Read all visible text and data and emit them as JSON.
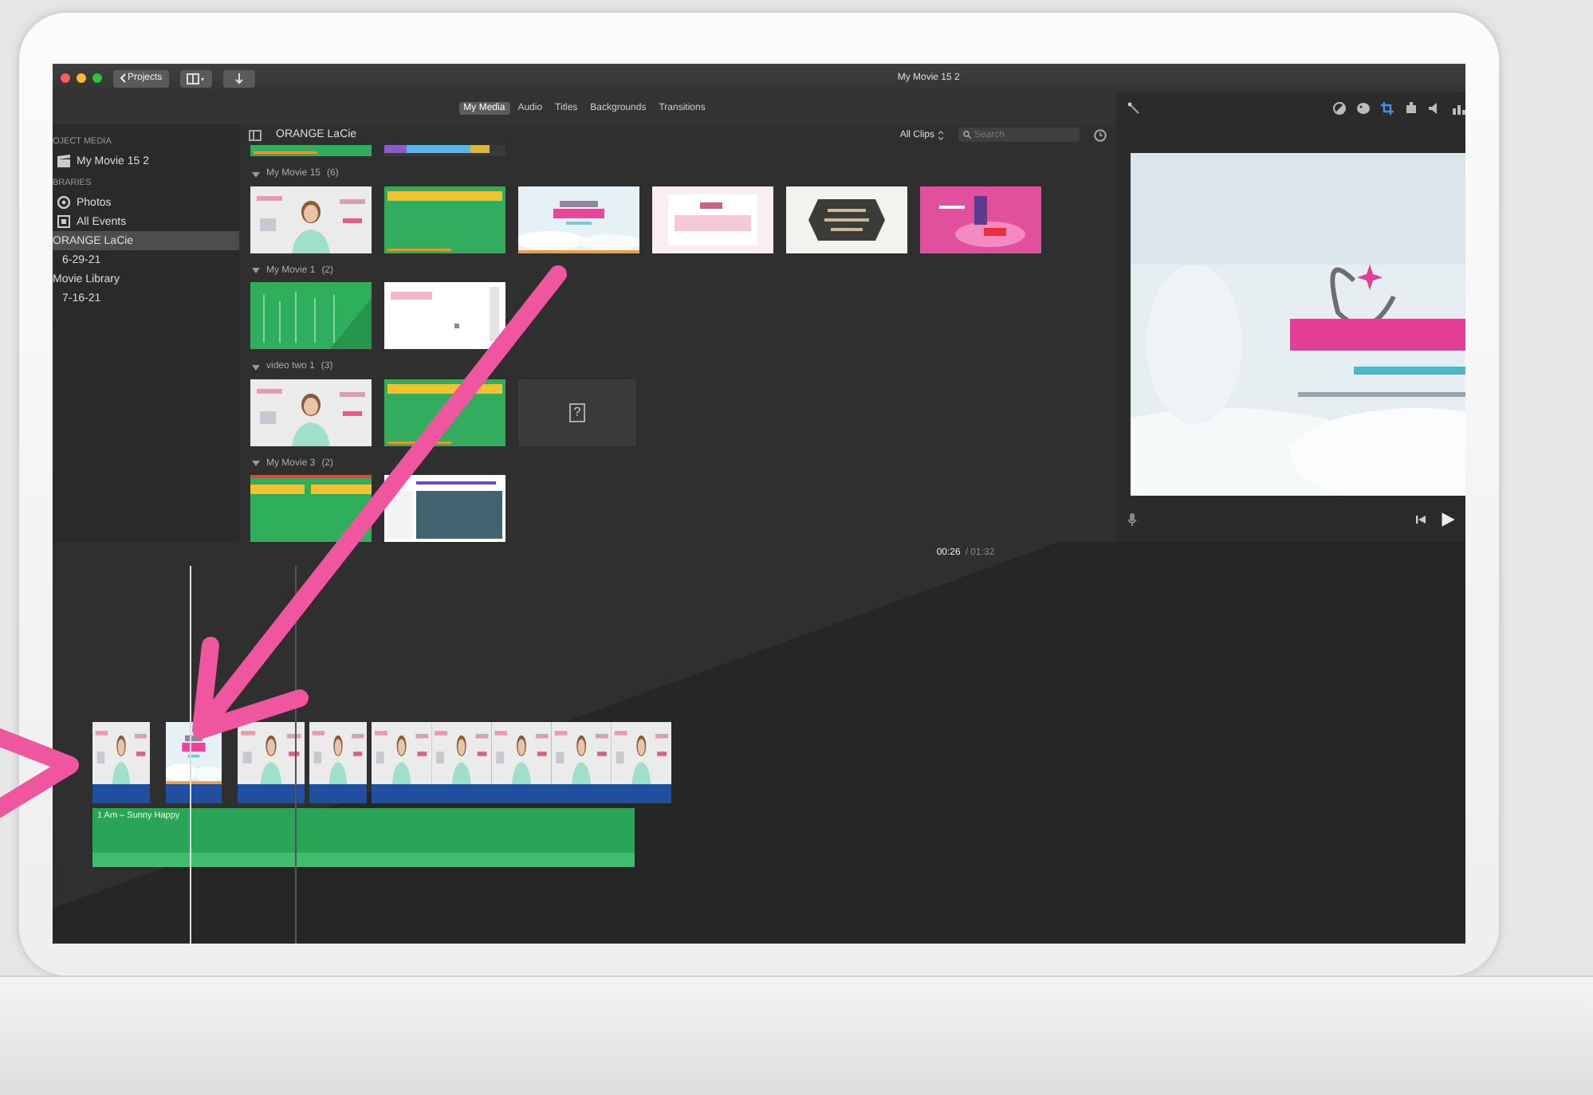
{
  "window": {
    "title": "My Movie 15 2",
    "controls": [
      {
        "kind": "close"
      },
      {
        "kind": "minimize"
      },
      {
        "kind": "zoom"
      }
    ],
    "toolbar": [
      {
        "kind": "projects",
        "label": "Projects"
      },
      {
        "kind": "clips"
      },
      {
        "kind": "import"
      }
    ]
  },
  "tabs": [
    {
      "label": "My Media",
      "selected": true
    },
    {
      "label": "Audio",
      "selected": false
    },
    {
      "label": "Titles",
      "selected": false
    },
    {
      "label": "Backgrounds",
      "selected": false
    },
    {
      "label": "Transitions",
      "selected": false
    }
  ],
  "sidebar": {
    "sections": [
      {
        "title": "OJECT MEDIA",
        "items": [
          {
            "label": "My Movie 15 2",
            "kind": "project",
            "selected": false
          }
        ]
      },
      {
        "title": "BRARIES",
        "items": [
          {
            "label": "Photos",
            "kind": "photos",
            "selected": false
          },
          {
            "label": "All Events",
            "kind": "events",
            "selected": false
          },
          {
            "label": "ORANGE LaCie",
            "kind": "library",
            "selected": true,
            "children": [
              {
                "label": "6-29-21",
                "selected": false
              }
            ]
          },
          {
            "label": "Movie Library",
            "kind": "library",
            "selected": false,
            "children": [
              {
                "label": "7-16-21",
                "selected": false
              }
            ]
          }
        ]
      }
    ]
  },
  "browser": {
    "title": "ORANGE LaCie",
    "filter": "All Clips",
    "search": {
      "placeholder": "Search"
    },
    "partial_row": [
      {
        "kind": "picture"
      },
      {
        "kind": "picture"
      }
    ],
    "groups": [
      {
        "name": "My Movie 15",
        "count": "(6)",
        "expanded": true,
        "thumbs": [
          {
            "kind": "picture"
          },
          {
            "kind": "picture"
          },
          {
            "kind": "picture"
          },
          {
            "kind": "picture"
          },
          {
            "kind": "picture"
          },
          {
            "kind": "picture"
          }
        ]
      },
      {
        "name": "My Movie 1",
        "count": "(2)",
        "expanded": true,
        "thumbs": [
          {
            "kind": "picture"
          },
          {
            "kind": "picture"
          }
        ]
      },
      {
        "name": "video two 1",
        "count": "(3)",
        "expanded": true,
        "thumbs": [
          {
            "kind": "picture"
          },
          {
            "kind": "picture"
          },
          {
            "kind": "missing",
            "label": "?"
          }
        ]
      },
      {
        "name": "My Movie 3",
        "count": "(2)",
        "expanded": true,
        "thumbs": [
          {
            "kind": "picture"
          },
          {
            "kind": "picture"
          }
        ]
      }
    ]
  },
  "viewer": {
    "tools": [
      {
        "kind": "balance",
        "selected": false
      },
      {
        "kind": "color",
        "selected": false
      },
      {
        "kind": "crop",
        "selected": true
      },
      {
        "kind": "stabilize",
        "selected": false
      },
      {
        "kind": "volume",
        "selected": false
      },
      {
        "kind": "noise",
        "selected": false
      }
    ],
    "preview": {
      "kind": "picture"
    }
  },
  "timeline": {
    "position": "00:26",
    "duration": "/ 01:32",
    "clips": [
      {
        "kind": "picture"
      },
      {
        "kind": "picture"
      },
      {
        "kind": "picture"
      },
      {
        "kind": "picture"
      },
      {
        "kind": "picture"
      }
    ],
    "music": {
      "title": "1 Am – Sunny Happy"
    }
  }
}
